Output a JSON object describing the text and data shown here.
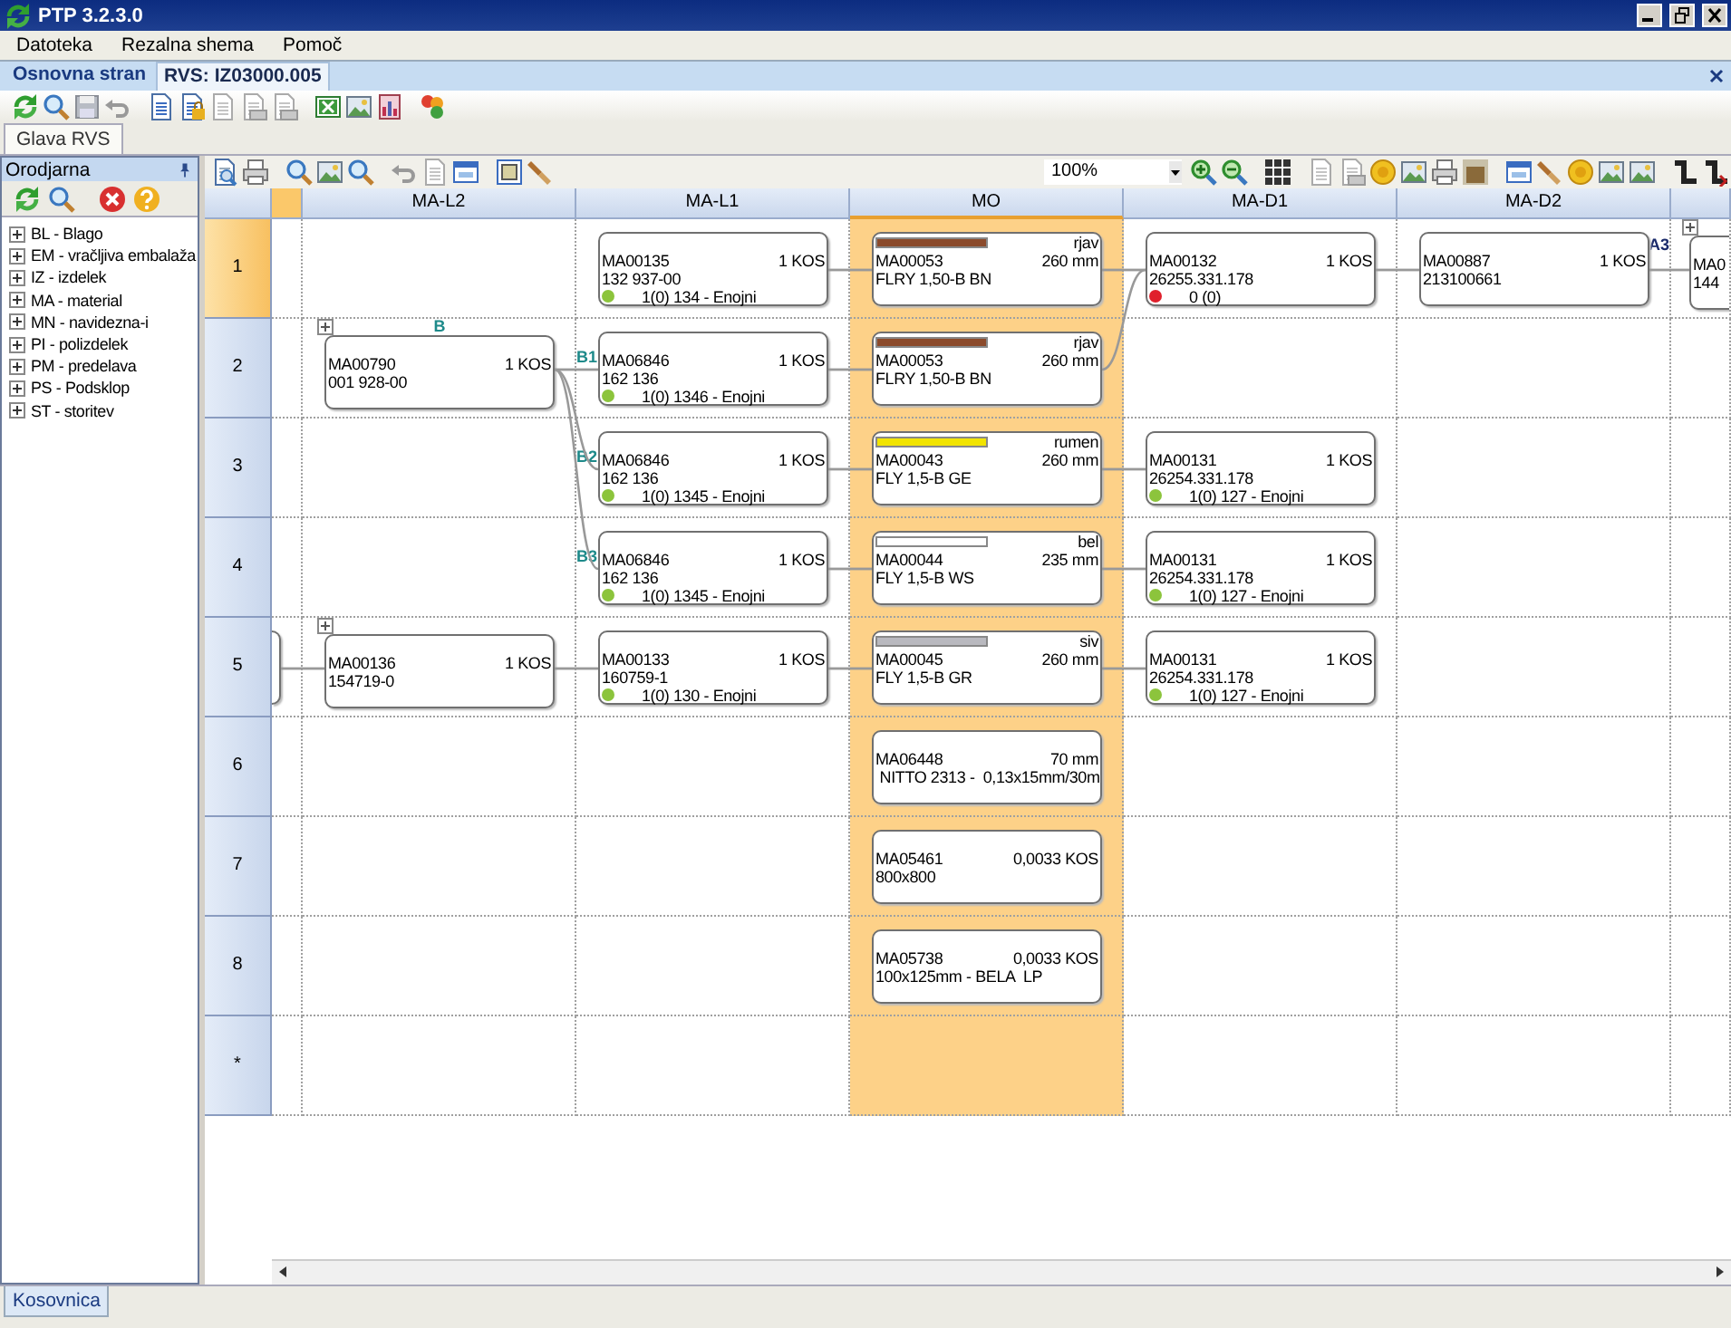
{
  "window": {
    "title": "PTP 3.2.3.0"
  },
  "menu": [
    "Datoteka",
    "Rezalna shema",
    "Pomoč"
  ],
  "document_tabs": [
    {
      "label": "Osnovna stran",
      "selected": false
    },
    {
      "label": "RVS: IZ03000.005",
      "selected": true
    }
  ],
  "sub_tabs": [
    {
      "label": "Glava RVS",
      "selected": true
    }
  ],
  "tool_panel": {
    "title": "Orodjarna",
    "tree": [
      {
        "label": "BL - Blago",
        "expanded": false
      },
      {
        "label": "EM - vračljiva embalaža",
        "expanded": false
      },
      {
        "label": "IZ - izdelek",
        "expanded": false
      },
      {
        "label": "MA - material",
        "expanded": false
      },
      {
        "label": "MN - navidezna-i",
        "expanded": false
      },
      {
        "label": "PI - polizdelek",
        "expanded": false
      },
      {
        "label": "PM - predelava",
        "expanded": false
      },
      {
        "label": "PS - Podsklop",
        "expanded": false
      },
      {
        "label": "ST - storitev",
        "expanded": false
      }
    ]
  },
  "zoom": {
    "value": "100%"
  },
  "columns": [
    {
      "label": "MA-L2",
      "selected": false
    },
    {
      "label": "MA-L1",
      "selected": false
    },
    {
      "label": "MO",
      "selected": true
    },
    {
      "label": "MA-D1",
      "selected": false
    },
    {
      "label": "MA-D2",
      "selected": false
    }
  ],
  "rows": [
    {
      "label": "1",
      "selected": true,
      "cells": [
        null,
        {
          "kind": "part",
          "code": "MA00135",
          "quantity": "1 KOS",
          "description": "132 937-00",
          "status": {
            "text": "1(0) 134 - Enojni",
            "color": "#8cc43c"
          },
          "expandable": false
        },
        {
          "kind": "wire",
          "wire": {
            "label": "rjav",
            "color": "#8b4a2b"
          },
          "code": "MA00053",
          "quantity": "260 mm",
          "description": "FLRY 1,50-B BN",
          "expandable": false,
          "linked_left": true
        },
        {
          "kind": "part",
          "code": "MA00132",
          "quantity": "1 KOS",
          "description": "26255.331.178",
          "status": {
            "text": "0 (0)",
            "color": "#e0202c"
          },
          "expandable": false,
          "linked_left": true
        },
        {
          "kind": "part",
          "code": "MA00887",
          "quantity": "1 KOS",
          "description": "213100661",
          "tag": {
            "text": "A3",
            "kind": "right"
          },
          "expandable": false,
          "linked_left": true
        }
      ],
      "overflow_right": {
        "kind": "part",
        "code": "MA0",
        "description": "144",
        "expandable": true,
        "linked_left": true
      }
    },
    {
      "label": "2",
      "selected": false,
      "cells": [
        {
          "kind": "part",
          "code": "MA00790",
          "quantity": "1 KOS",
          "description": "001 928-00",
          "tag": {
            "text": "B",
            "kind": "top"
          },
          "expandable": true
        },
        {
          "kind": "part",
          "code": "MA06846",
          "quantity": "1 KOS",
          "description": "162 136",
          "status": {
            "text": "1(0) 1346 - Enojni",
            "color": "#8cc43c"
          },
          "tag": {
            "text": "B1",
            "kind": "left"
          },
          "expandable": false,
          "linked_left": true
        },
        {
          "kind": "wire",
          "wire": {
            "label": "rjav",
            "color": "#8b4a2b"
          },
          "code": "MA00053",
          "quantity": "260 mm",
          "description": "FLRY 1,50-B BN",
          "expandable": false,
          "linked_left": true,
          "linked_right": true
        },
        null,
        null
      ]
    },
    {
      "label": "3",
      "selected": false,
      "cells": [
        null,
        {
          "kind": "part",
          "code": "MA06846",
          "quantity": "1 KOS",
          "description": "162 136",
          "status": {
            "text": "1(0) 1345 - Enojni",
            "color": "#8cc43c"
          },
          "tag": {
            "text": "B2",
            "kind": "left"
          },
          "expandable": false,
          "linked_left": true
        },
        {
          "kind": "wire",
          "wire": {
            "label": "rumen",
            "color": "#f2e400"
          },
          "code": "MA00043",
          "quantity": "260 mm",
          "description": "FLY 1,5-B GE",
          "expandable": false,
          "linked_left": true
        },
        {
          "kind": "part",
          "code": "MA00131",
          "quantity": "1 KOS",
          "description": "26254.331.178",
          "status": {
            "text": "1(0) 127 - Enojni",
            "color": "#8cc43c"
          },
          "expandable": false,
          "linked_left": true
        },
        null
      ]
    },
    {
      "label": "4",
      "selected": false,
      "cells": [
        null,
        {
          "kind": "part",
          "code": "MA06846",
          "quantity": "1 KOS",
          "description": "162 136",
          "status": {
            "text": "1(0) 1345 - Enojni",
            "color": "#8cc43c"
          },
          "tag": {
            "text": "B3",
            "kind": "left"
          },
          "expandable": false,
          "linked_left": true
        },
        {
          "kind": "wire",
          "wire": {
            "label": "bel",
            "color": "#ffffff"
          },
          "code": "MA00044",
          "quantity": "235 mm",
          "description": "FLY 1,5-B WS",
          "expandable": false,
          "linked_left": true
        },
        {
          "kind": "part",
          "code": "MA00131",
          "quantity": "1 KOS",
          "description": "26254.331.178",
          "status": {
            "text": "1(0) 127 - Enojni",
            "color": "#8cc43c"
          },
          "expandable": false,
          "linked_left": true
        },
        null
      ]
    },
    {
      "label": "5",
      "selected": false,
      "overflow_left": {
        "kind": "edge"
      },
      "cells": [
        {
          "kind": "part",
          "code": "MA00136",
          "quantity": "1 KOS",
          "description": "154719-0",
          "expandable": true,
          "linked_left": true
        },
        {
          "kind": "part",
          "code": "MA00133",
          "quantity": "1 KOS",
          "description": "160759-1",
          "status": {
            "text": "1(0) 130 - Enojni",
            "color": "#8cc43c"
          },
          "expandable": false,
          "linked_left": true
        },
        {
          "kind": "wire",
          "wire": {
            "label": "siv",
            "color": "#b9b9bf"
          },
          "code": "MA00045",
          "quantity": "260 mm",
          "description": "FLY 1,5-B GR",
          "expandable": false,
          "linked_left": true
        },
        {
          "kind": "part",
          "code": "MA00131",
          "quantity": "1 KOS",
          "description": "26254.331.178",
          "status": {
            "text": "1(0) 127 - Enojni",
            "color": "#8cc43c"
          },
          "expandable": false,
          "linked_left": true
        },
        null
      ]
    },
    {
      "label": "6",
      "selected": false,
      "cells": [
        null,
        null,
        {
          "kind": "part",
          "code": "MA06448",
          "quantity": "70 mm",
          "description": " NITTO 2313 -  0,13x15mm/30m",
          "expandable": false,
          "linked_left": false
        },
        null,
        null
      ]
    },
    {
      "label": "7",
      "selected": false,
      "cells": [
        null,
        null,
        {
          "kind": "part",
          "code": "MA05461",
          "quantity": "0,0033 KOS",
          "description": "800x800",
          "expandable": false,
          "linked_left": false
        },
        null,
        null
      ]
    },
    {
      "label": "8",
      "selected": false,
      "cells": [
        null,
        null,
        {
          "kind": "part",
          "code": "MA05738",
          "quantity": "0,0033 KOS",
          "description": "100x125mm - BELA  LP",
          "expandable": false,
          "linked_left": false
        },
        null,
        null
      ]
    },
    {
      "label": "*",
      "selected": false,
      "cells": [
        null,
        null,
        null,
        null,
        null
      ]
    }
  ],
  "bottom_tabs": [
    {
      "label": "Kosovnica",
      "selected": true
    }
  ]
}
